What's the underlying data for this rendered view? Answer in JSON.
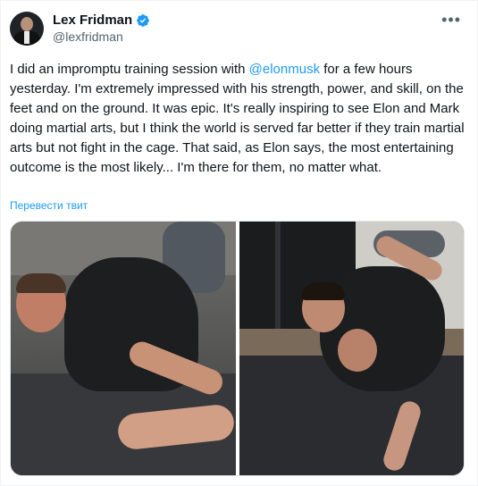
{
  "author": {
    "name": "Lex Fridman",
    "handle": "@lexfridman",
    "verified_icon": "verified-badge-icon"
  },
  "tweet": {
    "text_before": "I did an impromptu training session with ",
    "mention": "@elonmusk",
    "text_after": " for a few hours yesterday. I'm extremely impressed with his strength, power, and skill, on the feet and on the ground. It was epic. It's really inspiring to see Elon and Mark doing martial arts, but I think the world is served far better if they train martial arts but not fight in the cage. That said, as Elon says, the most entertaining outcome is the most likely... I'm there for them, no matter what.",
    "translate_label": "Перевести твит"
  },
  "more_icon": "more-horizontal-icon",
  "colors": {
    "accent": "#1d9bf0",
    "text": "#0f1419",
    "secondary": "#536471"
  }
}
